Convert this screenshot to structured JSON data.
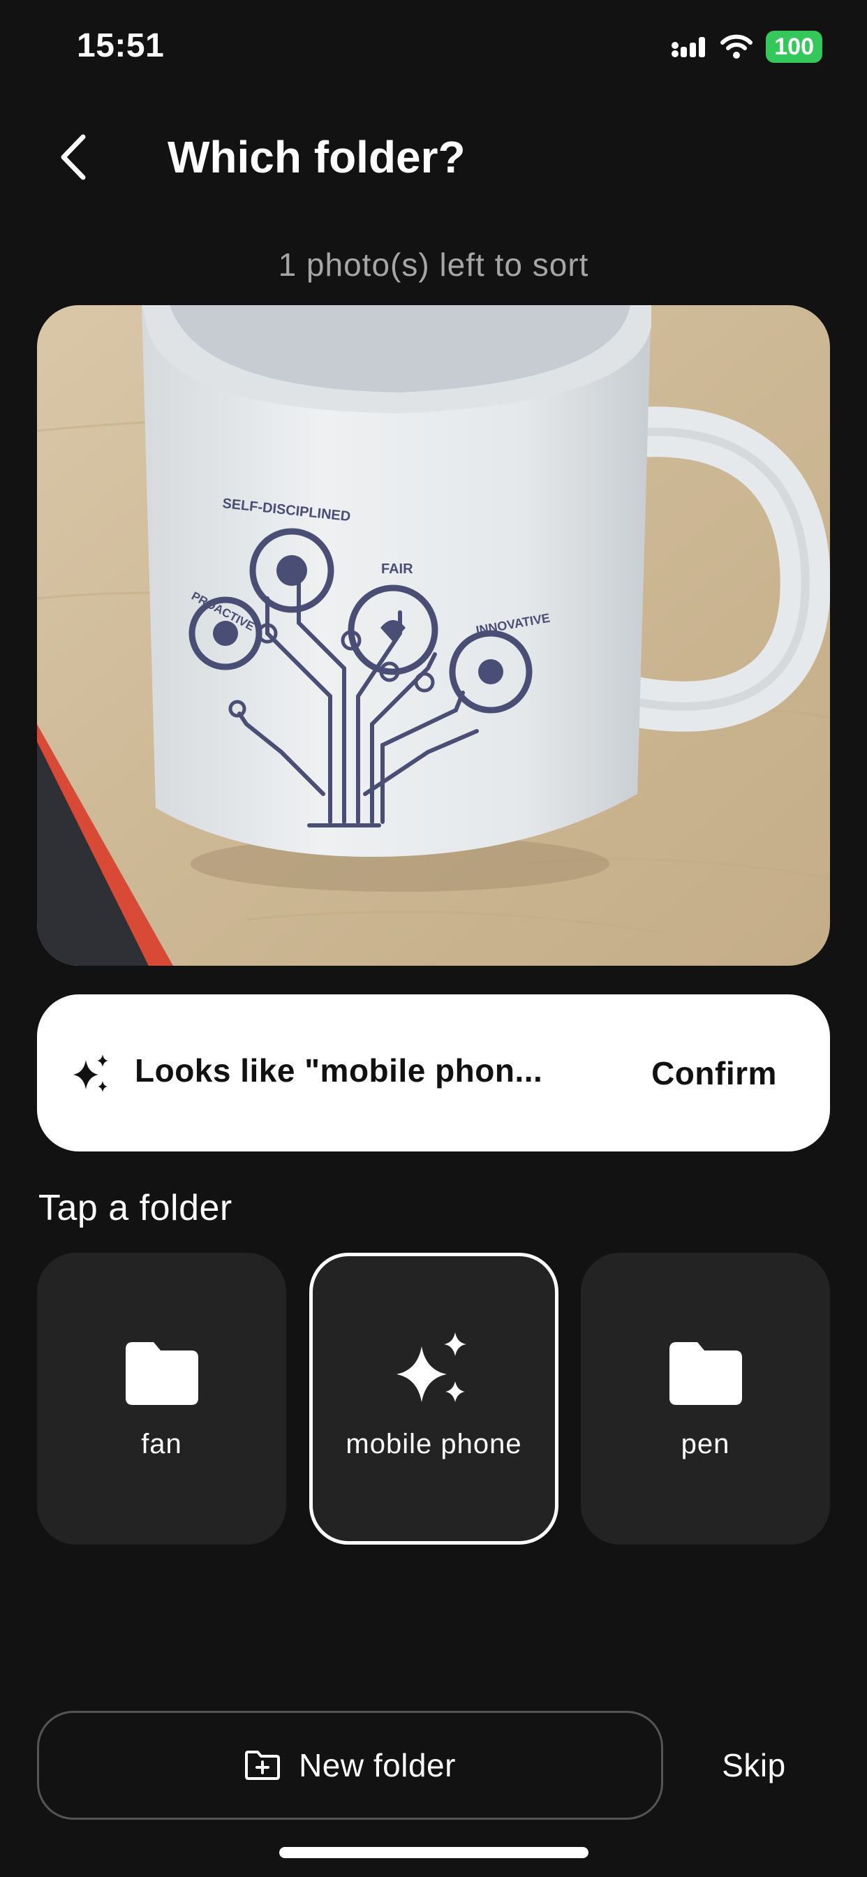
{
  "status_bar": {
    "time": "15:51",
    "battery": "100",
    "icons": [
      "cellular-signal-icon",
      "wifi-icon",
      "battery-icon"
    ]
  },
  "header": {
    "back_icon": "chevron-left-icon",
    "title": "Which folder?"
  },
  "progress_text": "1 photo(s) left to sort",
  "photo": {
    "mug_text": {
      "self_disciplined": "SELF-DISCIPLINED",
      "proactive": "PROACTIVE",
      "fair": "FAIR",
      "innovative": "INNOVATIVE"
    }
  },
  "suggestion": {
    "icon": "sparkles-icon",
    "text": "Looks like \"mobile phon...",
    "confirm_label": "Confirm"
  },
  "folders_section": {
    "label": "Tap a folder",
    "folders": [
      {
        "label": "fan",
        "icon": "folder-icon",
        "selected": false
      },
      {
        "label": "mobile phone",
        "icon": "sparkles-icon",
        "selected": true
      },
      {
        "label": "pen",
        "icon": "folder-icon",
        "selected": false
      }
    ]
  },
  "actions": {
    "new_folder_label": "New folder",
    "new_folder_icon": "folder-plus-icon",
    "skip_label": "Skip"
  },
  "colors": {
    "background": "#121212",
    "tile": "#232323",
    "battery": "#34c759",
    "card": "#ffffff"
  }
}
